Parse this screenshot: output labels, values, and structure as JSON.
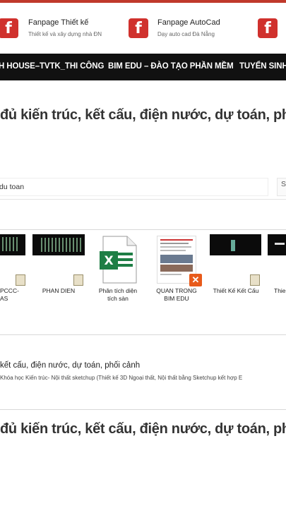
{
  "fanpages": [
    {
      "title": "Fanpage Thiết kế",
      "subtitle": "Thiết kế và xây dựng nhà ĐN"
    },
    {
      "title": "Fanpage AutoCad",
      "subtitle": "Dạy auto cad Đà Nẵng"
    },
    {
      "title": "",
      "subtitle": ""
    }
  ],
  "nav": {
    "items": [
      "H HOUSE–TVTK_THI CÔNG",
      "BIM EDU – ĐÀO TẠO PHẦN MỀM",
      "TUYỂN SINH"
    ]
  },
  "headline": "đủ kiến trúc, kết cấu, điện nước, dự toán, ph",
  "search": {
    "value": "du toan",
    "button_label": "Se"
  },
  "files": [
    {
      "label": "PCCC-\nAS"
    },
    {
      "label": "PHAN DIEN"
    },
    {
      "label": "Phân tích diện\ntích sàn"
    },
    {
      "label": "QUAN TRONG\nBIM EDU"
    },
    {
      "label": "Thiết Kế Kết Cấu"
    },
    {
      "label": "Thie"
    }
  ],
  "section": {
    "heading": "kết cấu, điện nước, dự toán, phối cảnh",
    "description": "Khóa học Kiến trúc- Nội thất sketchup (Thiết kế 3D Ngoại thất, Nội thất bằng Sketchup kết hợp E"
  },
  "headline_repeat": "đủ kiến trúc, kết cấu, điện nước, dự toán, ph",
  "colors": {
    "accent": "#d0312d",
    "navbar": "#111111",
    "excel_green": "#1e7e45",
    "pdf_orange": "#e85a1a"
  },
  "icons": {
    "facebook": "facebook-icon",
    "excel": "excel-file-icon",
    "pdf": "pdf-file-icon"
  }
}
